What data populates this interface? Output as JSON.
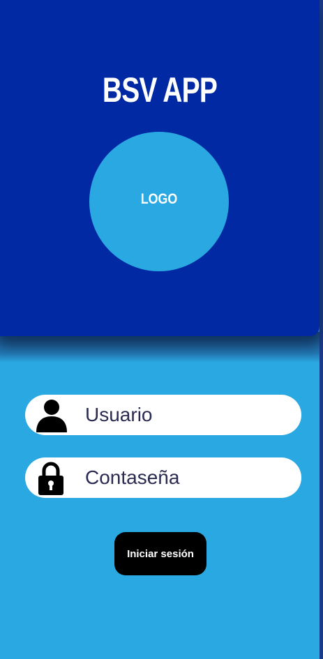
{
  "header": {
    "title": "BSV APP",
    "logo_text": "LOGO"
  },
  "form": {
    "username_label": "Usuario",
    "password_label": "Contaseña",
    "login_button": "Iniciar sesión"
  },
  "icons": {
    "username": "user-icon",
    "password": "lock-icon"
  },
  "colors": {
    "header_bg": "#0029a3",
    "page_bg": "#2aa8e2",
    "button_bg": "#000000"
  }
}
